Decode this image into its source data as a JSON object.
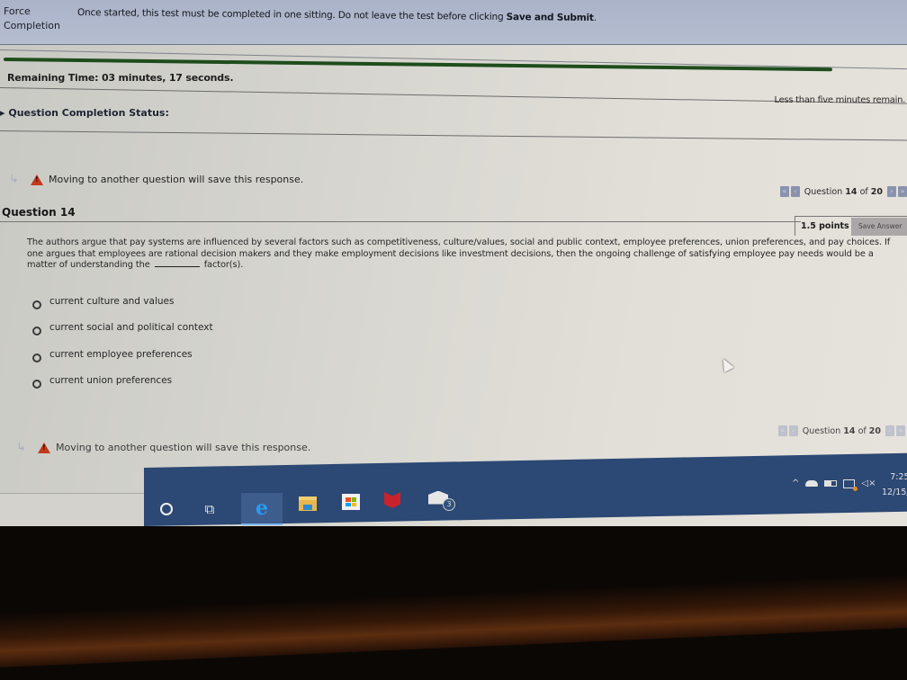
{
  "header": {
    "force_label": "Force Completion",
    "force_text": "Once started, this test must be completed in one sitting. Do not leave the test before clicking",
    "force_emphasis": "Save and Submit",
    "force_suffix": ".",
    "remaining_time": "Remaining Time: 03 minutes, 17 seconds.",
    "time_warning": "Less than five minutes remain.",
    "completion_status_label": "Question Completion Status:",
    "timer_progress_fraction": 0.93,
    "timer_bar_color": "#1e4d1c"
  },
  "notice": {
    "save_message": "Moving to another question will save this response."
  },
  "navigation": {
    "first_icon": "«",
    "prev_icon": "‹",
    "next_icon": "›",
    "last_icon": "»",
    "label_prefix": "Question",
    "current": "14",
    "of": "of",
    "total": "20"
  },
  "question": {
    "title": "Question 14",
    "points": "1.5 points",
    "save_answer_label": "Save Answer",
    "text_before_blank": "The authors argue that pay systems are influenced by several factors such as competitiveness, culture/values, social and public context, employee preferences, union preferences, and pay choices.  If one argues that employees are rational decision makers and they make employment decisions like investment decisions, then the ongoing challenge of satisfying employee pay needs would be a matter of understanding the",
    "text_after_blank": "factor(s).",
    "options": [
      {
        "label": "current culture and values",
        "selected": false
      },
      {
        "label": "current social and political context",
        "selected": false
      },
      {
        "label": "current employee preferences",
        "selected": false
      },
      {
        "label": "current union preferences",
        "selected": false
      }
    ]
  },
  "taskbar": {
    "apps": [
      "search-icon",
      "task-view-icon",
      "edge-icon",
      "file-explorer-icon",
      "store-icon",
      "mcafee-icon",
      "mail-icon"
    ],
    "taskview_glyph": "⧉",
    "edge_glyph": "e",
    "mail_badge": "3",
    "tray_chevron": "^",
    "volume_glyph": "🔇",
    "time": "7:25",
    "date": "12/15/"
  }
}
